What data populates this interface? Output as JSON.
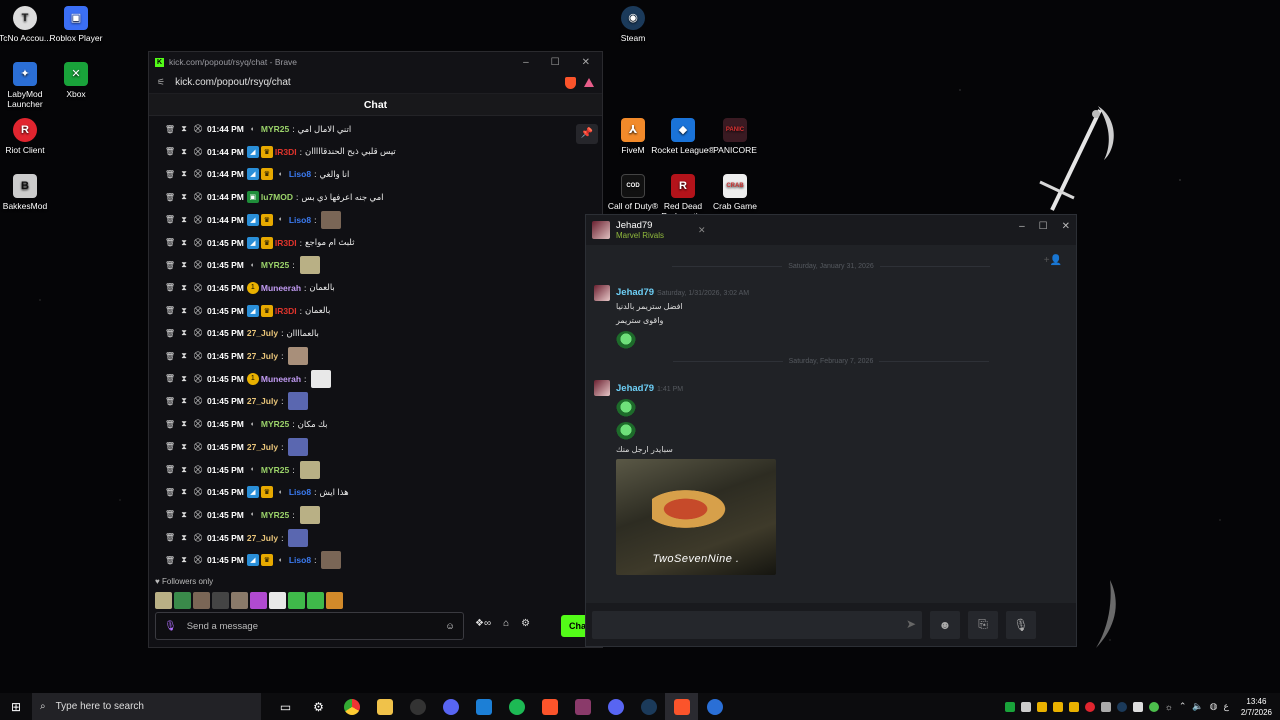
{
  "desktop": {
    "icons": [
      {
        "label": "TcNo Accou..."
      },
      {
        "label": "Roblox Player"
      },
      {
        "label": "LabyMod Launcher"
      },
      {
        "label": "Xbox"
      },
      {
        "label": "Riot Client"
      },
      {
        "label": "BakkesMod"
      },
      {
        "label": "Steam"
      },
      {
        "label": "FiveM"
      },
      {
        "label": "Rocket League®"
      },
      {
        "label": "PANICORE"
      },
      {
        "label": "Call of Duty®"
      },
      {
        "label": "Red Dead Redemoti..."
      },
      {
        "label": "Crab Game"
      }
    ]
  },
  "brave": {
    "window_title": "kick.com/popout/rsyq/chat - Brave",
    "address": "kick.com/popout/rsyq/chat",
    "chat_title": "Chat",
    "messages": [
      {
        "time": "01:44 PM",
        "user": "MYR25",
        "text": "اتني الامال امي",
        "color": "#9bd36a",
        "badges": [
          "moon"
        ]
      },
      {
        "time": "01:44 PM",
        "user": "IR3DI",
        "text": "تيس قلبي ذبح الحندقااااان",
        "color": "#e0342c",
        "badges": [
          "blue",
          "gold"
        ]
      },
      {
        "time": "01:44 PM",
        "user": "Liso8",
        "text": "انا والغي",
        "color": "#3b7bf2",
        "badges": [
          "blue",
          "gold",
          "moon"
        ]
      },
      {
        "time": "01:44 PM",
        "user": "lu7MOD",
        "text": "امي جنه اعرفها ذي بس",
        "color": "#9bd36a",
        "badges": [
          "sub"
        ]
      },
      {
        "time": "01:44 PM",
        "user": "Liso8",
        "text": "",
        "color": "#3b7bf2",
        "badges": [
          "blue",
          "gold",
          "moon"
        ],
        "emote": "#7a6656"
      },
      {
        "time": "01:45 PM",
        "user": "IR3DI",
        "text": "ثلبث ام مواجع",
        "color": "#e0342c",
        "badges": [
          "blue",
          "gold"
        ]
      },
      {
        "time": "01:45 PM",
        "user": "MYR25",
        "text": "",
        "color": "#9bd36a",
        "badges": [
          "moon"
        ],
        "emote": "#b9b085"
      },
      {
        "time": "01:45 PM",
        "user": "Muneerah",
        "text": "بالعمان",
        "color": "#c39cf5",
        "badges": [
          "yel"
        ]
      },
      {
        "time": "01:45 PM",
        "user": "IR3DI",
        "text": "بالعمان",
        "color": "#e0342c",
        "badges": [
          "blue",
          "gold"
        ]
      },
      {
        "time": "01:45 PM",
        "user": "27_July",
        "text": "بالعماااان",
        "color": "#e9c57a",
        "badges": []
      },
      {
        "time": "01:45 PM",
        "user": "27_July",
        "text": "",
        "color": "#e9c57a",
        "badges": [],
        "emote": "#a88f7a"
      },
      {
        "time": "01:45 PM",
        "user": "Muneerah",
        "text": "",
        "color": "#c39cf5",
        "badges": [
          "yel"
        ],
        "emote": "#e8e8e8"
      },
      {
        "time": "01:45 PM",
        "user": "27_July",
        "text": "",
        "color": "#e9c57a",
        "badges": [],
        "emote": "#5a67b0"
      },
      {
        "time": "01:45 PM",
        "user": "MYR25",
        "text": "بك مكان",
        "color": "#9bd36a",
        "badges": [
          "moon"
        ]
      },
      {
        "time": "01:45 PM",
        "user": "27_July",
        "text": "",
        "color": "#e9c57a",
        "badges": [],
        "emote": "#5a67b0"
      },
      {
        "time": "01:45 PM",
        "user": "MYR25",
        "text": "",
        "color": "#9bd36a",
        "badges": [
          "moon"
        ],
        "emote": "#b9b085"
      },
      {
        "time": "01:45 PM",
        "user": "Liso8",
        "text": "هذا ايش",
        "color": "#3b7bf2",
        "badges": [
          "blue",
          "gold",
          "moon"
        ]
      },
      {
        "time": "01:45 PM",
        "user": "MYR25",
        "text": "",
        "color": "#9bd36a",
        "badges": [
          "moon"
        ],
        "emote": "#b9b085"
      },
      {
        "time": "01:45 PM",
        "user": "27_July",
        "text": "",
        "color": "#e9c57a",
        "badges": [],
        "emote": "#5a67b0"
      },
      {
        "time": "01:45 PM",
        "user": "Liso8",
        "text": "",
        "color": "#3b7bf2",
        "badges": [
          "blue",
          "gold",
          "moon"
        ],
        "emote": "#7a6656"
      }
    ],
    "followers_only": "Followers only",
    "emote_colors": [
      "#b9b085",
      "#3a8a4a",
      "#7a6656",
      "#444",
      "#8a7a6a",
      "#b04ad0",
      "#e8e8e8",
      "#3fb94a",
      "#3fb94a",
      "#d28a2a"
    ],
    "send_placeholder": "Send a message",
    "chat_button": "Cha"
  },
  "steam": {
    "friend_name": "Jehad79",
    "friend_game": "Marvel Rivals",
    "date1": "Saturday, January 31, 2026",
    "msg1_name": "Jehad79",
    "msg1_time": "Saturday, 1/31/2026, 3:02 AM",
    "msg1_line1": "افضل ستريمر بالدنيا",
    "msg1_line2": "واقوى ستريمر",
    "date2": "Saturday, February 7, 2026",
    "msg2_name": "Jehad79",
    "msg2_time": "1:41 PM",
    "msg2_text": "سبايدر ارجل منك",
    "image_caption": "TwoSevenNine ."
  },
  "taskbar": {
    "search_placeholder": "Type here to search",
    "lang": "ع",
    "time": "13:46",
    "date": "2/7/2026"
  }
}
